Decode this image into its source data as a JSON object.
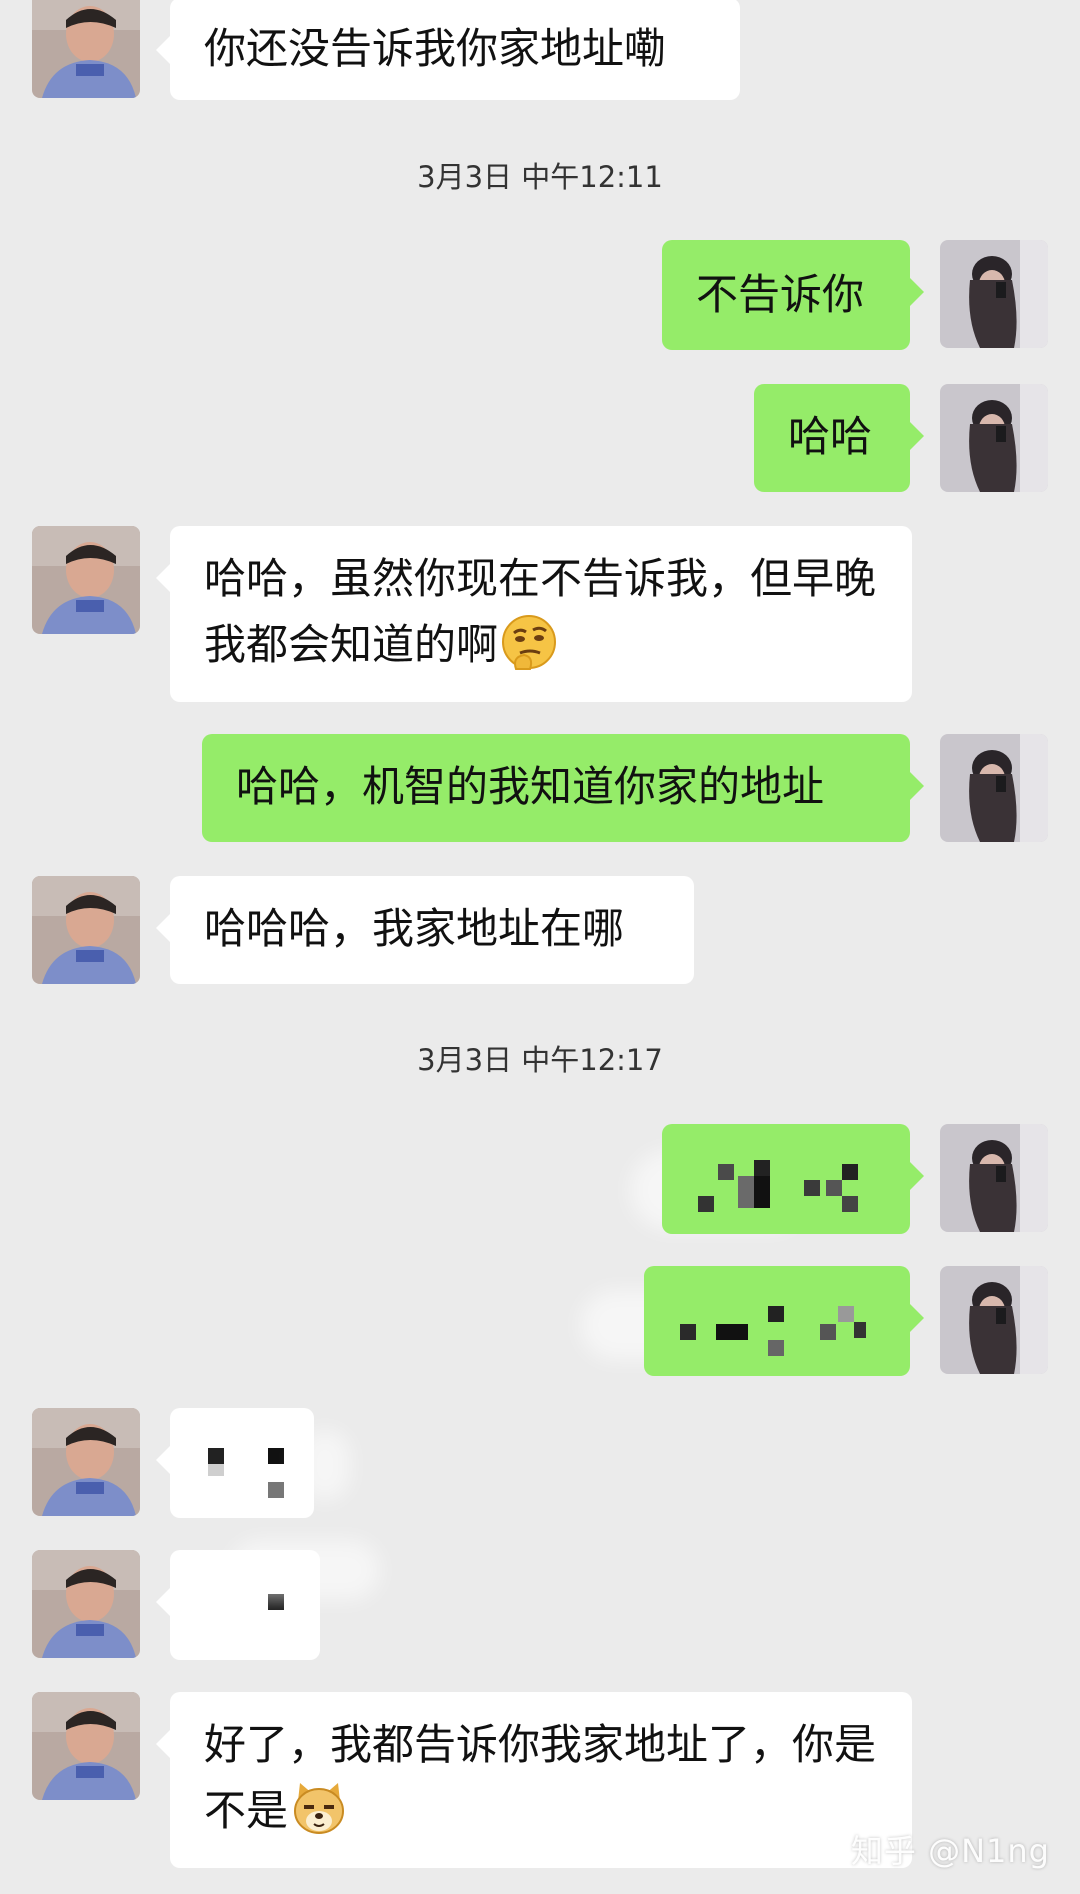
{
  "conversation": {
    "timestamps": [
      "3月3日 中午12:11",
      "3月3日 中午12:17"
    ],
    "messages": [
      {
        "side": "left",
        "text": "你还没告诉我你家地址嘞"
      },
      {
        "side": "right",
        "text": "不告诉你"
      },
      {
        "side": "right",
        "text": "哈哈"
      },
      {
        "side": "left",
        "text": "哈哈，虽然你现在不告诉我，但早晚我都会知道的啊",
        "emoji": "thinking-face-emoji"
      },
      {
        "side": "right",
        "text": "哈哈，机智的我知道你家的地址"
      },
      {
        "side": "left",
        "text": "哈哈哈，我家地址在哪"
      },
      {
        "side": "right",
        "content": "pixelated-redacted"
      },
      {
        "side": "right",
        "content": "pixelated-redacted"
      },
      {
        "side": "left",
        "content": "pixelated-redacted"
      },
      {
        "side": "left",
        "content": "pixelated-redacted"
      },
      {
        "side": "left",
        "text": "好了，我都告诉你我家地址了，你是不是",
        "emoji": "doge-emoji"
      }
    ]
  },
  "colors": {
    "background": "#ebebeb",
    "incoming_bubble": "#ffffff",
    "outgoing_bubble": "#95ec69"
  },
  "watermark": "知乎 @N1ng"
}
